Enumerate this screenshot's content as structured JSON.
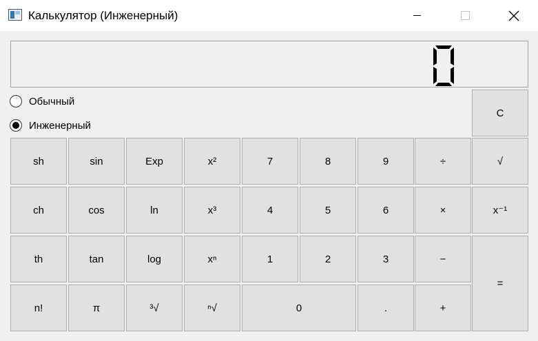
{
  "window": {
    "title": "Калькулятор (Инженерный)",
    "icon": "calculator-app-icon",
    "controls": [
      "minimize-icon",
      "maximize-icon",
      "close-icon"
    ]
  },
  "display": {
    "value": "0"
  },
  "modes": [
    {
      "label": "Обычный",
      "selected": false
    },
    {
      "label": "Инженерный",
      "selected": true
    }
  ],
  "buttons": {
    "clear": "C",
    "sh": "sh",
    "sin": "sin",
    "exp": "Exp",
    "sq": "x²",
    "d7": "7",
    "d8": "8",
    "d9": "9",
    "div": "÷",
    "sqrt": "√",
    "ch": "ch",
    "cos": "cos",
    "ln": "ln",
    "cube": "x³",
    "d4": "4",
    "d5": "5",
    "d6": "6",
    "mul": "×",
    "inv": "x⁻¹",
    "th": "th",
    "tan": "tan",
    "log": "log",
    "pow": "xⁿ",
    "d1": "1",
    "d2": "2",
    "d3": "3",
    "sub": "−",
    "eq": "=",
    "fact": "n!",
    "pi": "π",
    "cbrt": "³√",
    "nroot": "ⁿ√",
    "d0": "0",
    "dot": ".",
    "add": "+"
  }
}
